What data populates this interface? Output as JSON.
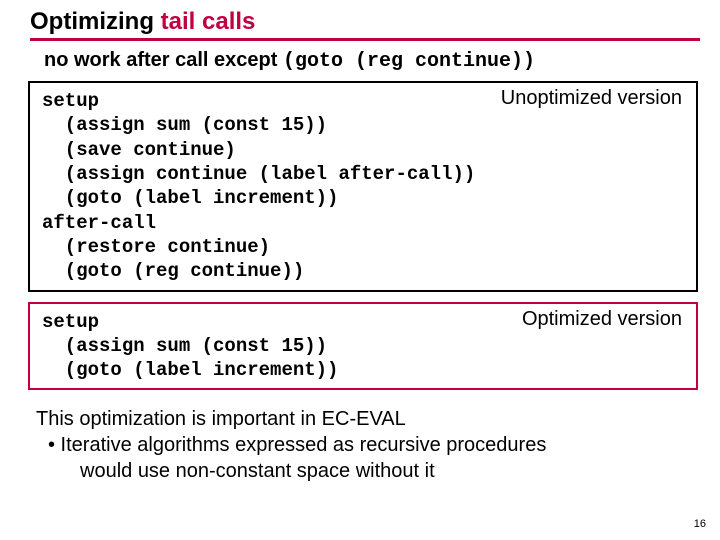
{
  "title": {
    "pre": "Optimizing ",
    "red": "tail calls"
  },
  "subtitle": {
    "bold": "no work after call except ",
    "mono": "(goto (reg continue))"
  },
  "unopt": {
    "label": "Unoptimized version",
    "code": "setup\n  (assign sum (const 15))\n  (save continue)\n  (assign continue (label after-call))\n  (goto (label increment))\nafter-call\n  (restore continue)\n  (goto (reg continue))"
  },
  "opt": {
    "label": "Optimized version",
    "code": "setup\n  (assign sum (const 15))\n  (goto (label increment))"
  },
  "footer": {
    "line1": "This optimization is important in EC-EVAL",
    "bullet1a": "• Iterative algorithms expressed as recursive procedures",
    "bullet1b": "would use non-constant space without it"
  },
  "pagenum": "16"
}
